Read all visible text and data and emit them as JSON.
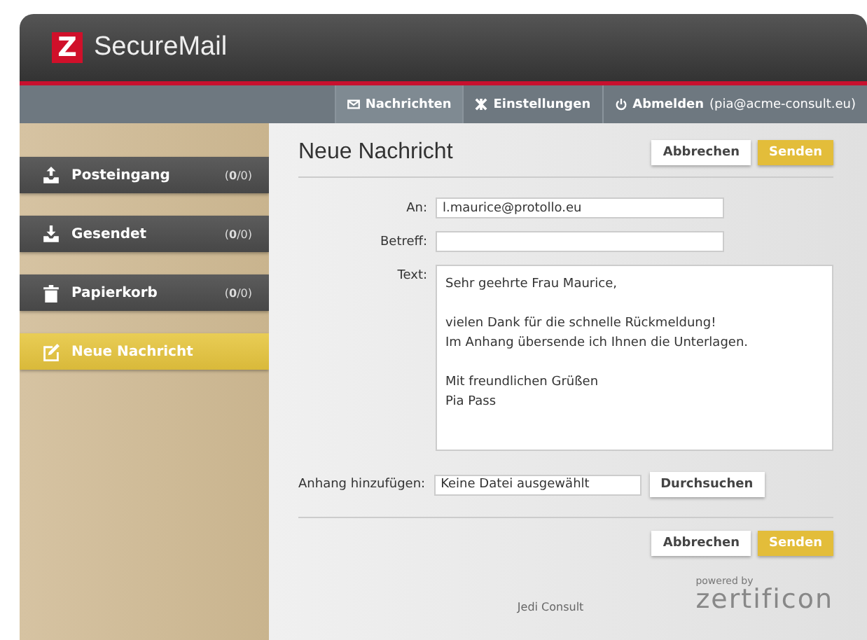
{
  "app": {
    "logo_letter": "Z",
    "title": "SecureMail"
  },
  "nav": [
    {
      "kind": "mail",
      "label": "Nachrichten",
      "selected": true
    },
    {
      "kind": "settings",
      "label": "Einstellungen",
      "selected": false
    },
    {
      "kind": "power",
      "label": "Abmelden",
      "detail": "(pia@acme-consult.eu)",
      "selected": false
    }
  ],
  "sidebar": {
    "items": [
      {
        "kind": "inbox",
        "label": "Posteingang",
        "count": "(**0**/0)",
        "selected": false
      },
      {
        "kind": "sent",
        "label": "Gesendet",
        "count": "(**0**/0)",
        "selected": false
      },
      {
        "kind": "trash",
        "label": "Papierkorb",
        "count": "(**0**/0)",
        "selected": false
      },
      {
        "kind": "compose",
        "label": "Neue Nachricht",
        "selected": true
      }
    ]
  },
  "compose": {
    "title": "Neue Nachricht",
    "top_buttons": [
      {
        "kind": "secondary",
        "label": "Abbrechen"
      },
      {
        "kind": "primary",
        "label": "Senden"
      }
    ],
    "to": {
      "label": "An:",
      "value": "l.maurice@protollo.eu"
    },
    "subject": {
      "label": "Betreff:"
    },
    "text": {
      "label": "Text:",
      "value": "Sehr geehrte Frau Maurice,\n\nvielen Dank für die schnelle Rückmeldung!\nIm Anhang übersende ich Ihnen die Unterlagen.\n\nMit freundlichen Grüßen\nPia Pass"
    },
    "attachment": {
      "label": "Anhang hinzufügen:",
      "value": "Keine Datei ausgewählt",
      "button": "Durchsuchen"
    },
    "bottom_buttons": [
      {
        "kind": "secondary",
        "label": "Abbrechen"
      },
      {
        "kind": "primary",
        "label": "Senden"
      }
    ]
  },
  "footer": {
    "company": "Jedi Consult",
    "powered_by": "powered by",
    "brand": "zertificon"
  }
}
